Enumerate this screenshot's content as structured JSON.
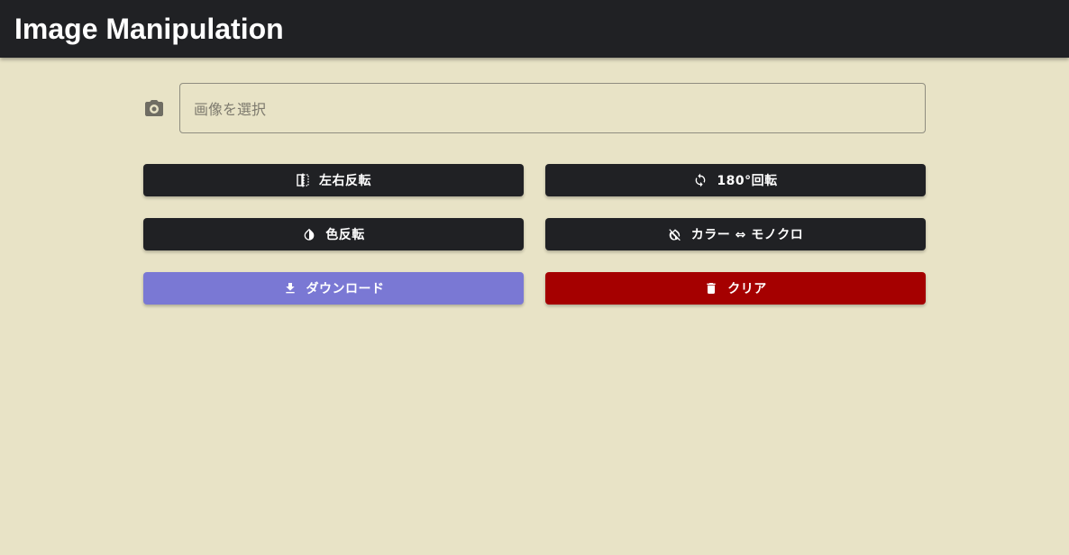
{
  "app": {
    "title": "Image Manipulation"
  },
  "file_input": {
    "icon": "camera-icon",
    "placeholder": "画像を選択"
  },
  "buttons": {
    "flip_horizontal": {
      "label": "左右反転",
      "icon": "flip-icon",
      "color": "#202124"
    },
    "rotate_180": {
      "label": "180°回転",
      "icon": "rotate-icon",
      "color": "#202124"
    },
    "invert_color": {
      "label": "色反転",
      "icon": "contrast-icon",
      "color": "#202124"
    },
    "grayscale_toggle": {
      "label": "カラー ⇔ モノクロ",
      "icon": "invert-colors-off-icon",
      "color": "#202124"
    },
    "download": {
      "label": "ダウンロード",
      "icon": "download-icon",
      "color": "#7a78d4"
    },
    "clear": {
      "label": "クリア",
      "icon": "trash-icon",
      "color": "#a50000"
    }
  },
  "colors": {
    "background": "#e8e3c6",
    "appbar": "#202124"
  }
}
